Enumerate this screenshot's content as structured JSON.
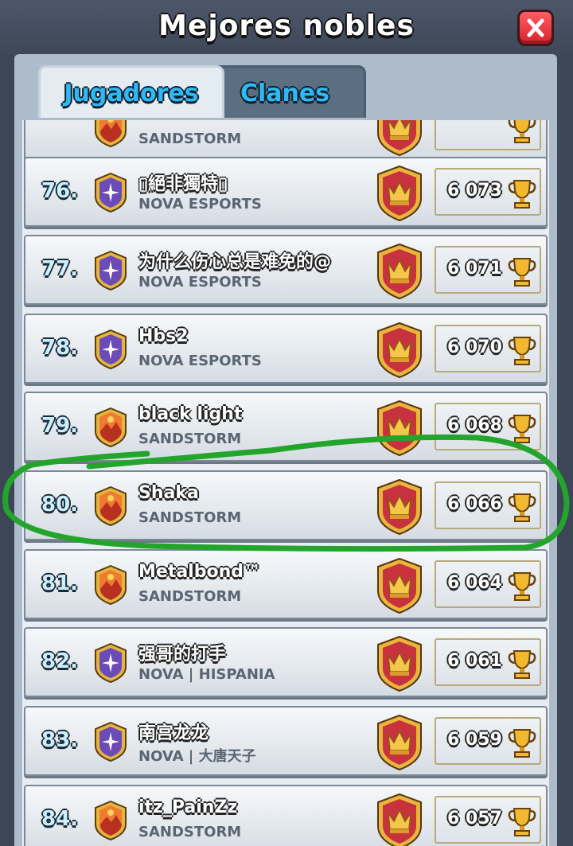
{
  "header": {
    "title": "Mejores nobles"
  },
  "tabs": [
    {
      "label": "Jugadores",
      "active": true
    },
    {
      "label": "Clanes",
      "active": false
    }
  ],
  "rows": [
    {
      "rank": "",
      "name": "",
      "clan": "Sandstorm",
      "trophies": "",
      "badge": "sandstorm"
    },
    {
      "rank": "76.",
      "name": "▯絕非獨特▯",
      "clan": "Nova eSports",
      "trophies": "6 073",
      "badge": "nova"
    },
    {
      "rank": "77.",
      "name": "为什么伤心总是难免的@",
      "clan": "Nova eSports",
      "trophies": "6 071",
      "badge": "nova"
    },
    {
      "rank": "78.",
      "name": "Hbs2",
      "clan": "Nova eSports",
      "trophies": "6 070",
      "badge": "nova"
    },
    {
      "rank": "79.",
      "name": "black light",
      "clan": "Sandstorm",
      "trophies": "6 068",
      "badge": "sandstorm"
    },
    {
      "rank": "80.",
      "name": "Shaka",
      "clan": "Sandstorm",
      "trophies": "6 066",
      "badge": "sandstorm"
    },
    {
      "rank": "81.",
      "name": "Metalbond™",
      "clan": "Sandstorm",
      "trophies": "6 064",
      "badge": "sandstorm"
    },
    {
      "rank": "82.",
      "name": "强哥的打手",
      "clan": "Nova | Hispania",
      "trophies": "6 061",
      "badge": "nova"
    },
    {
      "rank": "83.",
      "name": "南宫龙龙",
      "clan": "Nova | 大唐天子",
      "trophies": "6 059",
      "badge": "nova"
    },
    {
      "rank": "84.",
      "name": "itz_PainZz",
      "clan": "Sandstorm",
      "trophies": "6 057",
      "badge": "sandstorm"
    }
  ],
  "colors": {
    "highlight_stroke": "#22a52a",
    "nova_badge": "#6b4bb8",
    "sandstorm_badge": "#d9582c",
    "league_badge": "#c8323f"
  },
  "icons": {
    "close": "close-x-icon",
    "trophy": "trophy-icon",
    "league": "crown-league-icon",
    "nova": "nova-star-badge-icon",
    "sandstorm": "sandstorm-mountain-badge-icon"
  }
}
